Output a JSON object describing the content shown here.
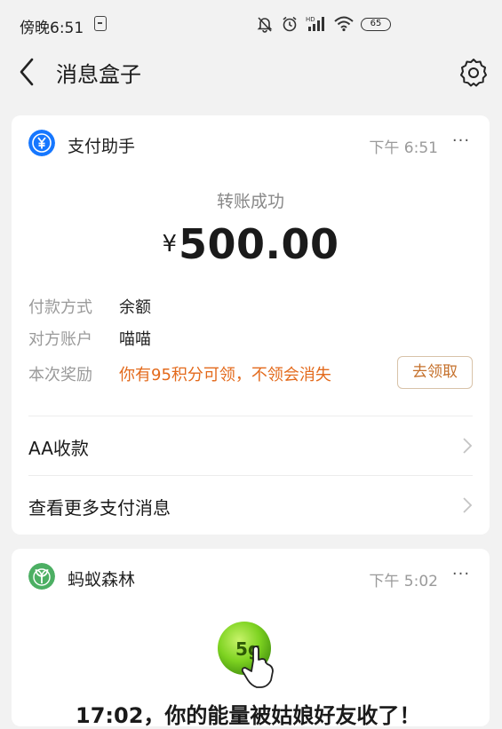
{
  "status_bar": {
    "time": "傍晚6:51",
    "battery": "65",
    "icons": [
      "app-badge-icon",
      "mute-bell-icon",
      "alarm-icon",
      "hd-signal-icon",
      "wifi-icon",
      "battery-icon"
    ]
  },
  "header": {
    "title": "消息盒子",
    "back_icon": "chevron-left-icon",
    "settings_icon": "gear-icon"
  },
  "cards": [
    {
      "source": "支付助手",
      "time": "下午 6:51",
      "more": "···",
      "status": "转账成功",
      "currency": "¥",
      "amount": "500.00",
      "details": [
        {
          "label": "付款方式",
          "value": "余额"
        },
        {
          "label": "对方账户",
          "value": "喵喵"
        },
        {
          "label": "本次奖励",
          "value": "你有95积分可领，不领会消失"
        }
      ],
      "claim_button": "去领取",
      "links": [
        "AA收款",
        "查看更多支付消息"
      ]
    },
    {
      "source": "蚂蚁森林",
      "time": "下午 5:02",
      "more": "···",
      "energy_label": "5g",
      "message_partial": "17:02，你的能量被姑娘好友收了！"
    }
  ],
  "colors": {
    "page_bg": "#f2f2f2",
    "alipay_blue": "#1677ff",
    "forest_green": "#4caf63",
    "reward_orange": "#e36a1c",
    "energy_green": "#7ed321"
  }
}
